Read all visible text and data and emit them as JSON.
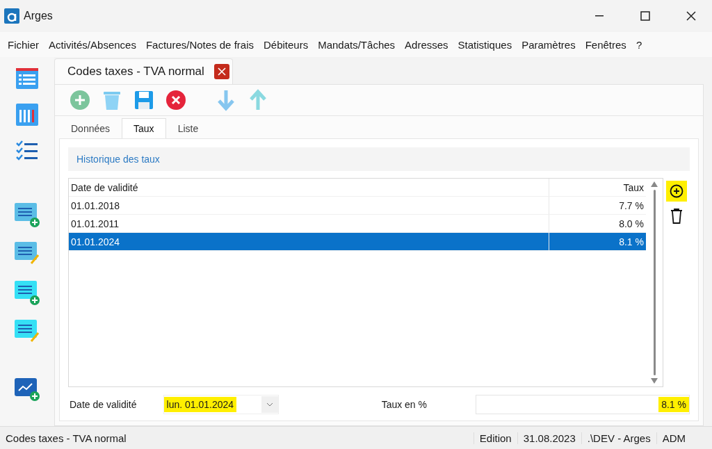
{
  "window": {
    "title": "Arges"
  },
  "menu": [
    "Fichier",
    "Activités/Absences",
    "Factures/Notes de frais",
    "Débiteurs",
    "Mandats/Tâches",
    "Adresses",
    "Statistiques",
    "Paramètres",
    "Fenêtres",
    "?"
  ],
  "document_tab": {
    "title": "Codes taxes - TVA normal"
  },
  "tabs": [
    {
      "label": "Données",
      "selected": false
    },
    {
      "label": "Taux",
      "selected": true
    },
    {
      "label": "Liste",
      "selected": false
    }
  ],
  "section_title": "Historique des taux",
  "table": {
    "columns": [
      "Date de validité",
      "Taux"
    ],
    "rows": [
      {
        "date": "01.01.2018",
        "rate": "7.7 %",
        "selected": false
      },
      {
        "date": "01.01.2011",
        "rate": "8.0 %",
        "selected": false
      },
      {
        "date": "01.01.2024",
        "rate": "8.1 %",
        "selected": true
      }
    ]
  },
  "form": {
    "date_label": "Date de validité",
    "date_value": "lun. 01.01.2024",
    "date_highlighted": true,
    "rate_label": "Taux en %",
    "rate_value": "8.1 %",
    "rate_highlighted": true
  },
  "status_bar": [
    "Codes taxes - TVA normal",
    "Edition",
    "31.08.2023",
    ".\\DEV - Arges",
    "ADM"
  ]
}
